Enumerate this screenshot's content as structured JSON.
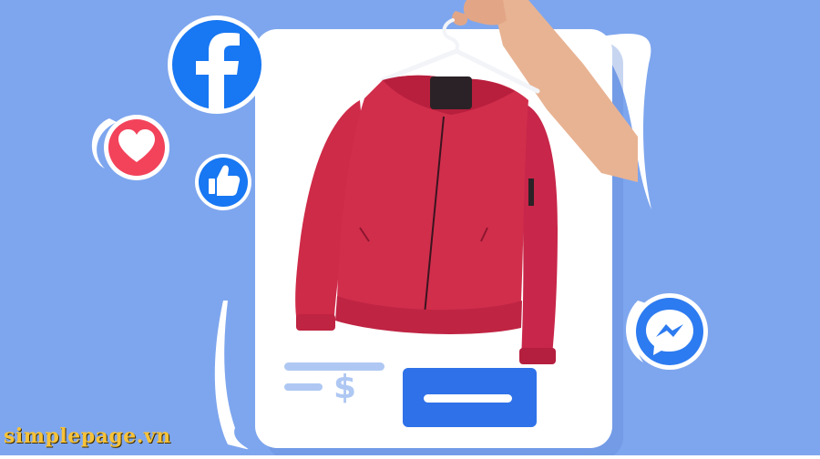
{
  "watermark": {
    "text": "simplepage.vn"
  },
  "card": {
    "price_symbol": "$"
  },
  "icons": {
    "facebook": "facebook-logo-icon",
    "heart": "heart-reaction-icon",
    "like": "thumbs-up-icon",
    "messenger": "messenger-icon",
    "dollar": "dollar-icon",
    "hanger": "hanger-icon"
  },
  "colors": {
    "background": "#7EA6EE",
    "card": "#FFFFFF",
    "facebook_blue": "#1877F2",
    "heart_red": "#F2435B",
    "jacket_red": "#D12E4C",
    "line_light_blue": "#AFC8F3",
    "watermark_yellow": "#F6C23A"
  }
}
